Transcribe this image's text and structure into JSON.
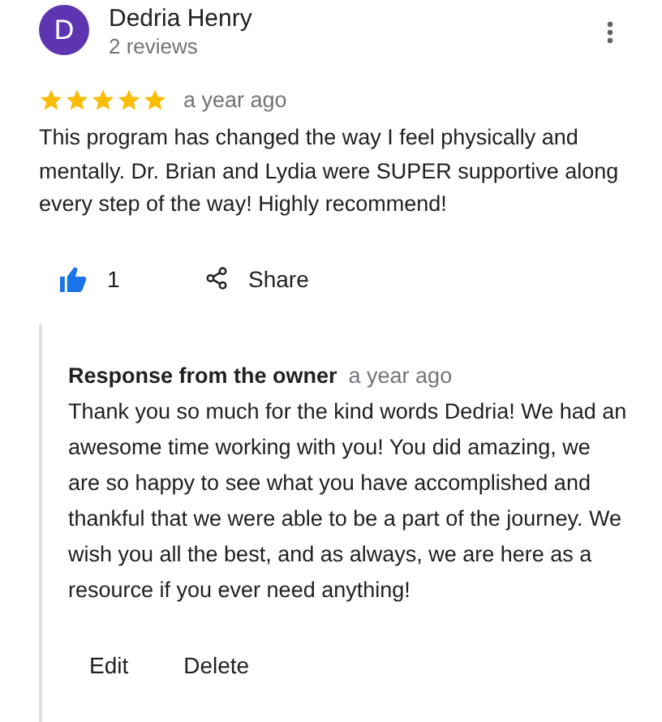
{
  "reviewer": {
    "initial": "D",
    "name": "Dedria Henry",
    "reviews": "2 reviews"
  },
  "review": {
    "stars": 5,
    "time": "a year ago",
    "text": "This program has changed the way I feel physically and mentally. Dr. Brian and Lydia were SUPER supportive along every step of the way! Highly recommend!"
  },
  "actions": {
    "liked": true,
    "like_count": "1",
    "share": "Share"
  },
  "owner_response": {
    "title": "Response from the owner",
    "time": "a year ago",
    "text": "Thank you so much for the kind words Dedria! We had an awesome time working with you! You did amazing, we are so happy to see what you have accomplished and thankful that we were able to be a part of the journey. We wish you all the best, and as always, we are here as a resource if you ever need anything!",
    "buttons": [
      "Edit",
      "Delete"
    ]
  }
}
